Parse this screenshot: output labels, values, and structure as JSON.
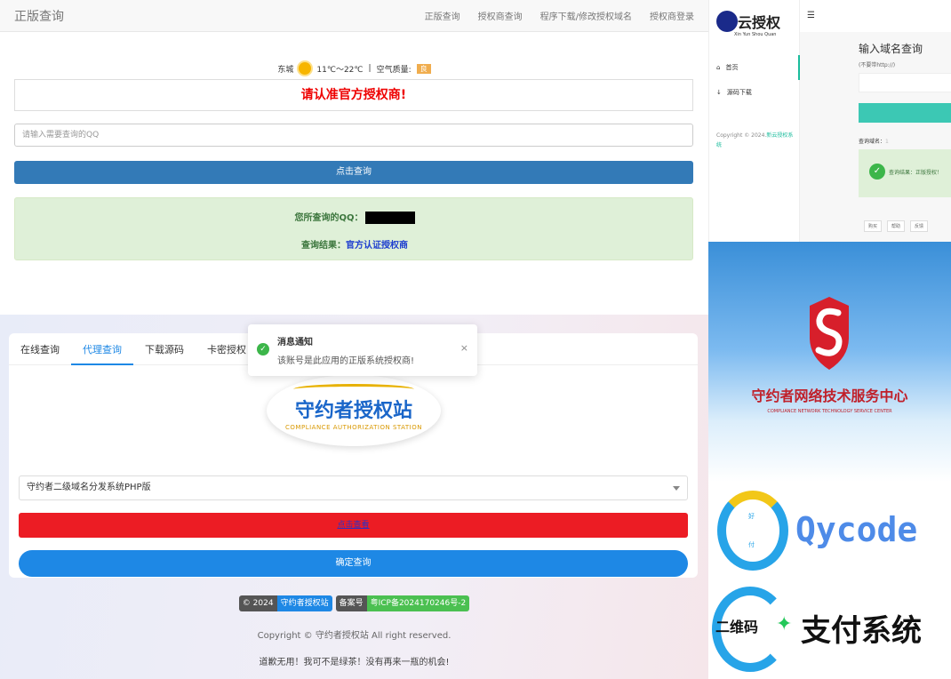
{
  "top_panel": {
    "brand": "正版查询",
    "nav_links": [
      "正版查询",
      "授权商查询",
      "程序下载/修改授权域名",
      "授权商登录"
    ],
    "weather": {
      "city": "东城",
      "temp": "11℃～22℃",
      "sep": "|",
      "aq_label": "空气质量:",
      "aq_value": "良"
    },
    "banner": "请认准官方授权商!",
    "qq_placeholder": "请输入需要查询的QQ",
    "query_button": "点击查询",
    "result": {
      "qq_label": "您所查询的QQ：",
      "result_label": "查询结果：",
      "result_value": "官方认证授权商"
    }
  },
  "bottom_panel": {
    "tabs": [
      "在线查询",
      "代理查询",
      "下载源码",
      "卡密授权"
    ],
    "active_tab": 1,
    "logo_main": "守约者授权站",
    "logo_sub": "COMPLIANCE AUTHORIZATION STATION",
    "select_value": "守约者二级域名分发系统PHP版",
    "red_button": "点击查看",
    "confirm_button": "确定查询",
    "toast": {
      "title": "消息通知",
      "body": "该账号是此应用的正版系统授权商!",
      "close": "×"
    },
    "badges": [
      {
        "left": "© 2024",
        "right": "守约者授权站"
      },
      {
        "left": "备案号",
        "right": "粤ICP备2024170246号-2"
      }
    ],
    "copyright": "Copyright © 守约者授权站 All right reserved.",
    "slogan": "道歉无用！我可不是绿茶！没有再来一瓶的机会!"
  },
  "right_top": {
    "logo_text": "云授权",
    "logo_sub": "Xin Yun Shou Quan",
    "menu": [
      "首页",
      "源码下载"
    ],
    "copyright_prefix": "Copyright © 2024.",
    "copyright_link": "新云授权系统",
    "hamburger": "☰",
    "title": "输入域名查询",
    "hint": "(不要带http://)",
    "domain_label": "查询域名：",
    "domain_value": "1",
    "result_text": "查询结果：正版授权！",
    "footer": [
      "购买",
      "帮助",
      "反馈"
    ]
  },
  "right_mid": {
    "title": "守约者网络技术服务中心",
    "subtitle": "COMPLIANCE NETWORK TECHNOLOGY SERVICE CENTER"
  },
  "right_bottom": {
    "qycode_text": "Qycode",
    "ring_top": "好",
    "ring_bottom": "付",
    "pay_left": "二维码",
    "pay_right": "支付系统"
  },
  "colors": {
    "primary": "#337ab7",
    "blue": "#1e88e5",
    "red": "#ec1c24",
    "green": "#3cb64a",
    "teal": "#1abc9c"
  }
}
